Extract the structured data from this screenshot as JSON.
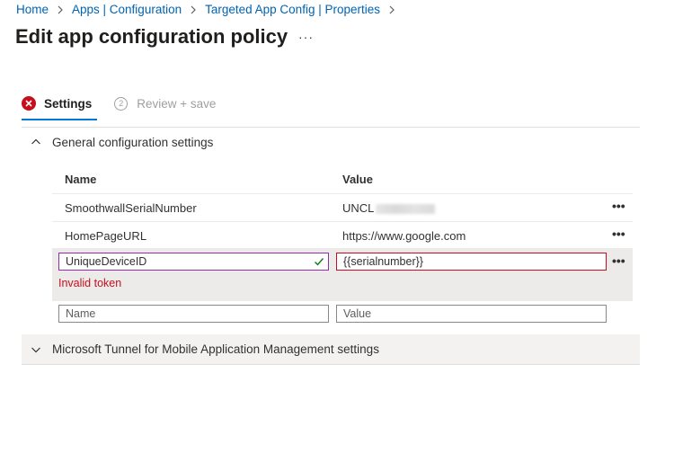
{
  "breadcrumb": {
    "items": [
      "Home",
      "Apps | Configuration",
      "Targeted App Config | Properties"
    ]
  },
  "page": {
    "title": "Edit app configuration policy",
    "more_label": "···"
  },
  "tabs": [
    {
      "label": "Settings",
      "state": "error",
      "icon": "error-circle-icon"
    },
    {
      "label": "Review + save",
      "step": "2",
      "state": "disabled"
    }
  ],
  "sections": {
    "general": {
      "label": "General configuration settings",
      "expanded": true
    },
    "tunnel": {
      "label": "Microsoft Tunnel for Mobile Application Management settings",
      "expanded": false
    }
  },
  "grid": {
    "columns": {
      "name": "Name",
      "value": "Value"
    },
    "rows": [
      {
        "name": "SmoothwallSerialNumber",
        "value": "UNCL",
        "value_redacted": true,
        "more": "•••"
      },
      {
        "name": "HomePageURL",
        "value": "https://www.google.com",
        "more": "•••"
      }
    ],
    "editing_row": {
      "name": "UniqueDeviceID",
      "value": "{{serialnumber}}",
      "name_valid": true,
      "error": "Invalid token",
      "more": "•••"
    },
    "new_row": {
      "name_placeholder": "Name",
      "value_placeholder": "Value"
    }
  },
  "colors": {
    "link": "#0063b1",
    "accent": "#0078d4",
    "error": "#c50f1f",
    "valid_check": "#107c10",
    "focus_border": "#8f2fa6"
  }
}
